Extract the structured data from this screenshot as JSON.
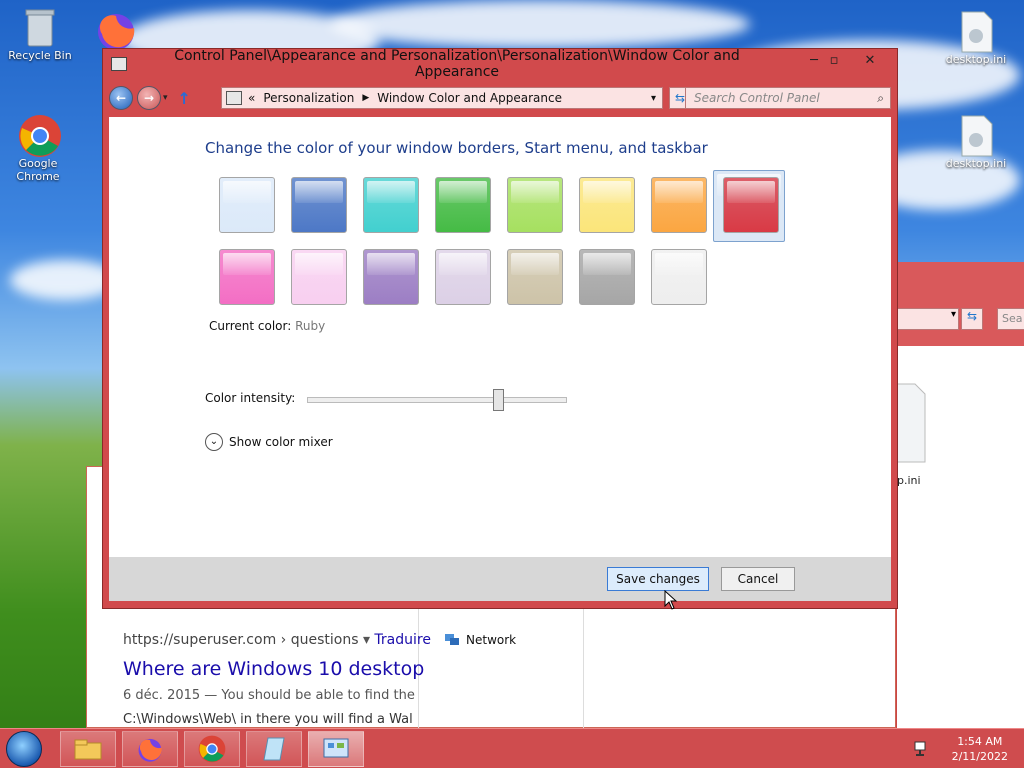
{
  "desktop": {
    "icons": [
      {
        "label": "Recycle Bin"
      },
      {
        "label": "Google Chrome"
      },
      {
        "label": "desktop.ini"
      },
      {
        "label": "desktop.ini"
      }
    ]
  },
  "dialog": {
    "title": "Control Panel\\Appearance and Personalization\\Personalization\\Window Color and Appearance",
    "breadcrumb_prefix": "«",
    "breadcrumb": [
      "Personalization",
      "Window Color and Appearance"
    ],
    "search_placeholder": "Search Control Panel",
    "heading": "Change the color of your window borders, Start menu, and taskbar",
    "swatches": [
      {
        "name": "sky",
        "color": "#dbe9f9"
      },
      {
        "name": "twilight",
        "color": "#4d78c6"
      },
      {
        "name": "sea-foam",
        "color": "#42d0cf"
      },
      {
        "name": "leaf",
        "color": "#45bb45"
      },
      {
        "name": "lime",
        "color": "#a6e060"
      },
      {
        "name": "lemon",
        "color": "#fbe57a"
      },
      {
        "name": "pumpkin",
        "color": "#fba641"
      },
      {
        "name": "ruby",
        "color": "#d93a45",
        "selected": true
      },
      {
        "name": "fuchsia",
        "color": "#f36ec4"
      },
      {
        "name": "blush",
        "color": "#f8cff0"
      },
      {
        "name": "violet",
        "color": "#9c7ec4"
      },
      {
        "name": "lavender",
        "color": "#dcd0e6"
      },
      {
        "name": "taupe",
        "color": "#cdc3a8"
      },
      {
        "name": "chocolate",
        "color": "#a6a6a6"
      },
      {
        "name": "slate",
        "color": "#eeeeee"
      }
    ],
    "current_color_label": "Current color:",
    "current_color_value": "Ruby",
    "intensity_label": "Color intensity:",
    "intensity_level": 0.73,
    "mixer_label": "Show color mixer",
    "save_label": "Save changes",
    "cancel_label": "Cancel"
  },
  "background": {
    "search_url": "https://superuser.com › questions",
    "translate": "Traduire",
    "result_title": "Where are Windows 10 desktop",
    "snippet1": "6 déc. 2015 — You should be able to find the",
    "snippet2": "C:\\Windows\\Web\\ in there you will find a Wal",
    "explorer_search": "Sea",
    "desktop_ini": "p.ini",
    "network_label": "Network"
  },
  "taskbar": {
    "time": "1:54 AM",
    "date": "2/11/2022"
  },
  "colors": {
    "accent": "#d14a4c"
  }
}
